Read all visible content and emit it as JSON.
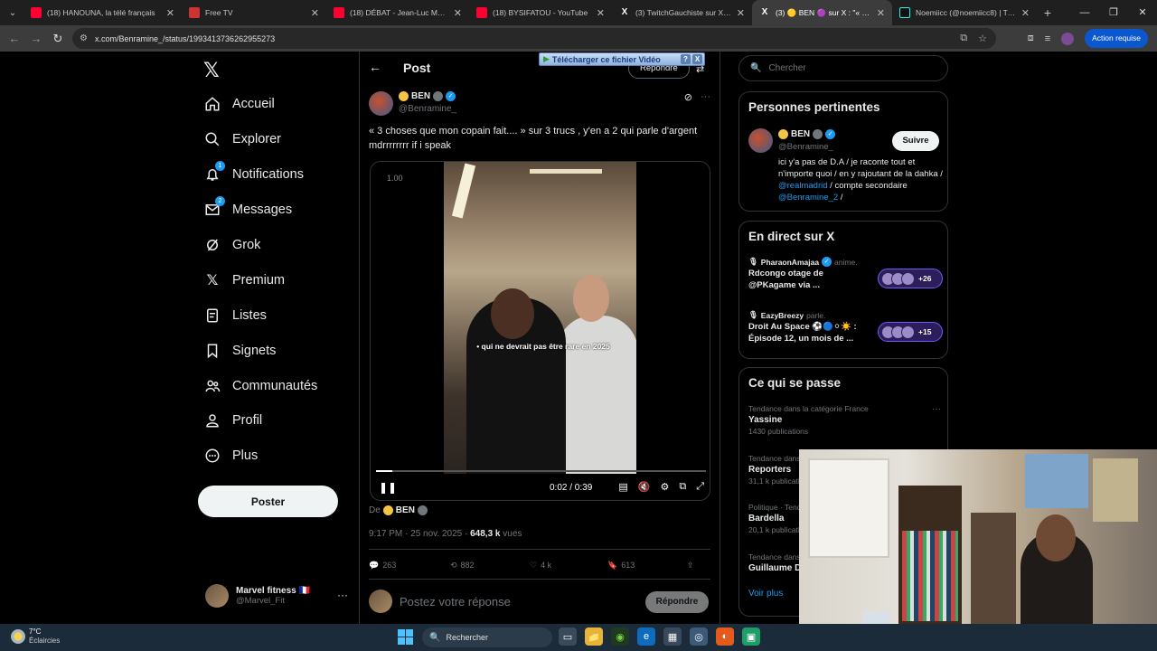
{
  "browser": {
    "tabs": [
      {
        "label": "(18) HANOUNA, la télé français",
        "icon": "youtube-icon",
        "active": false
      },
      {
        "label": "Free TV",
        "icon": "free-tv-icon",
        "active": false
      },
      {
        "label": "(18) DÉBAT - Jean-Luc Mélench",
        "icon": "youtube-icon",
        "active": false
      },
      {
        "label": "(18) BYSIFATOU - YouTube",
        "icon": "youtube-icon",
        "active": false
      },
      {
        "label": "(3) TwitchGauchiste sur X : \"AT",
        "icon": "x-icon",
        "active": false
      },
      {
        "label": "(3) 🟡 BEN 🟣 sur X : \"« 3 cho",
        "icon": "x-icon",
        "active": true
      },
      {
        "label": "Noemiicc (@noemiicc8) | TikTo",
        "icon": "tiktok-icon",
        "active": false
      }
    ],
    "url": "x.com/Benramine_/status/1993413736262955273",
    "action_required": "Action requise"
  },
  "nav": {
    "items": [
      {
        "label": "Accueil",
        "icon": "home-icon"
      },
      {
        "label": "Explorer",
        "icon": "search-icon"
      },
      {
        "label": "Notifications",
        "icon": "bell-icon",
        "badge": "1"
      },
      {
        "label": "Messages",
        "icon": "envelope-icon",
        "badge": "2"
      },
      {
        "label": "Grok",
        "icon": "grok-icon"
      },
      {
        "label": "Premium",
        "icon": "x-logo-icon"
      },
      {
        "label": "Listes",
        "icon": "list-icon"
      },
      {
        "label": "Signets",
        "icon": "bookmark-icon"
      },
      {
        "label": "Communautés",
        "icon": "communities-icon"
      },
      {
        "label": "Profil",
        "icon": "profile-icon"
      },
      {
        "label": "Plus",
        "icon": "more-circle-icon"
      }
    ],
    "post_button": "Poster",
    "account": {
      "name": "Marvel fitness 🇫🇷",
      "handle": "@Marvel_Fit"
    }
  },
  "post": {
    "header_title": "Post",
    "reply_top": "Répondre",
    "download_bar": "Télécharger ce fichier Vidéo",
    "author_name": "BEN",
    "author_handle": "@Benramine_",
    "text": "« 3 choses que mon copain fait.... » sur 3 trucs , y'en a 2 qui parle d'argent mdrrrrrrrr if i speak",
    "video": {
      "speed": "1.00",
      "caption": "• qui ne devrait pas être rare en 2025",
      "time": "0:02 / 0:39",
      "progress_fraction": 0.05
    },
    "from_label": "De",
    "from_name": "BEN",
    "time": "9:17 PM · 25 nov. 2025 ·",
    "views_count": "648,3 k",
    "views_label": "vues",
    "stats": {
      "replies": "263",
      "reposts": "882",
      "likes": "4 k",
      "bookmarks": "613"
    },
    "composer_placeholder": "Postez votre réponse",
    "composer_button": "Répondre"
  },
  "sidebar": {
    "search_placeholder": "Chercher",
    "relevant": {
      "title": "Personnes pertinentes",
      "name": "BEN",
      "handle": "@Benramine_",
      "follow": "Suivre",
      "bio_1": "ici y'a pas de D.A / je raconte tout et n'importe quoi / en y rajoutant de la dahka / ",
      "bio_link1": "@realmadrid",
      "bio_2": " / compte secondaire ",
      "bio_link2": "@Benramine_2",
      "bio_3": " /"
    },
    "live": {
      "title": "En direct sur X",
      "items": [
        {
          "host": "PharaonAmajaa",
          "state": "anime.",
          "title": "Rdcongo otage de @PKagame via ...",
          "count": "+26"
        },
        {
          "host": "EazyBreezy",
          "state": "parle.",
          "title": "Droit Au Space ⚽🔵⚪☀️ : Épisode 12, un mois de ...",
          "count": "+15"
        }
      ]
    },
    "trends": {
      "title": "Ce qui se passe",
      "items": [
        {
          "category": "Tendance dans la catégorie France",
          "title": "Yassine",
          "count": "1430 publications"
        },
        {
          "category": "Tendance dans",
          "title": "Reporters",
          "count": "31,1 k publications"
        },
        {
          "category": "Politique · Tend",
          "title": "Bardella",
          "count": "20,1 k publications"
        },
        {
          "category": "Tendance dans",
          "title": "Guillaume D",
          "count": ""
        }
      ],
      "see_more": "Voir plus"
    }
  },
  "taskbar": {
    "temperature": "7°C",
    "weather": "Éclaircies",
    "search": "Rechercher"
  }
}
